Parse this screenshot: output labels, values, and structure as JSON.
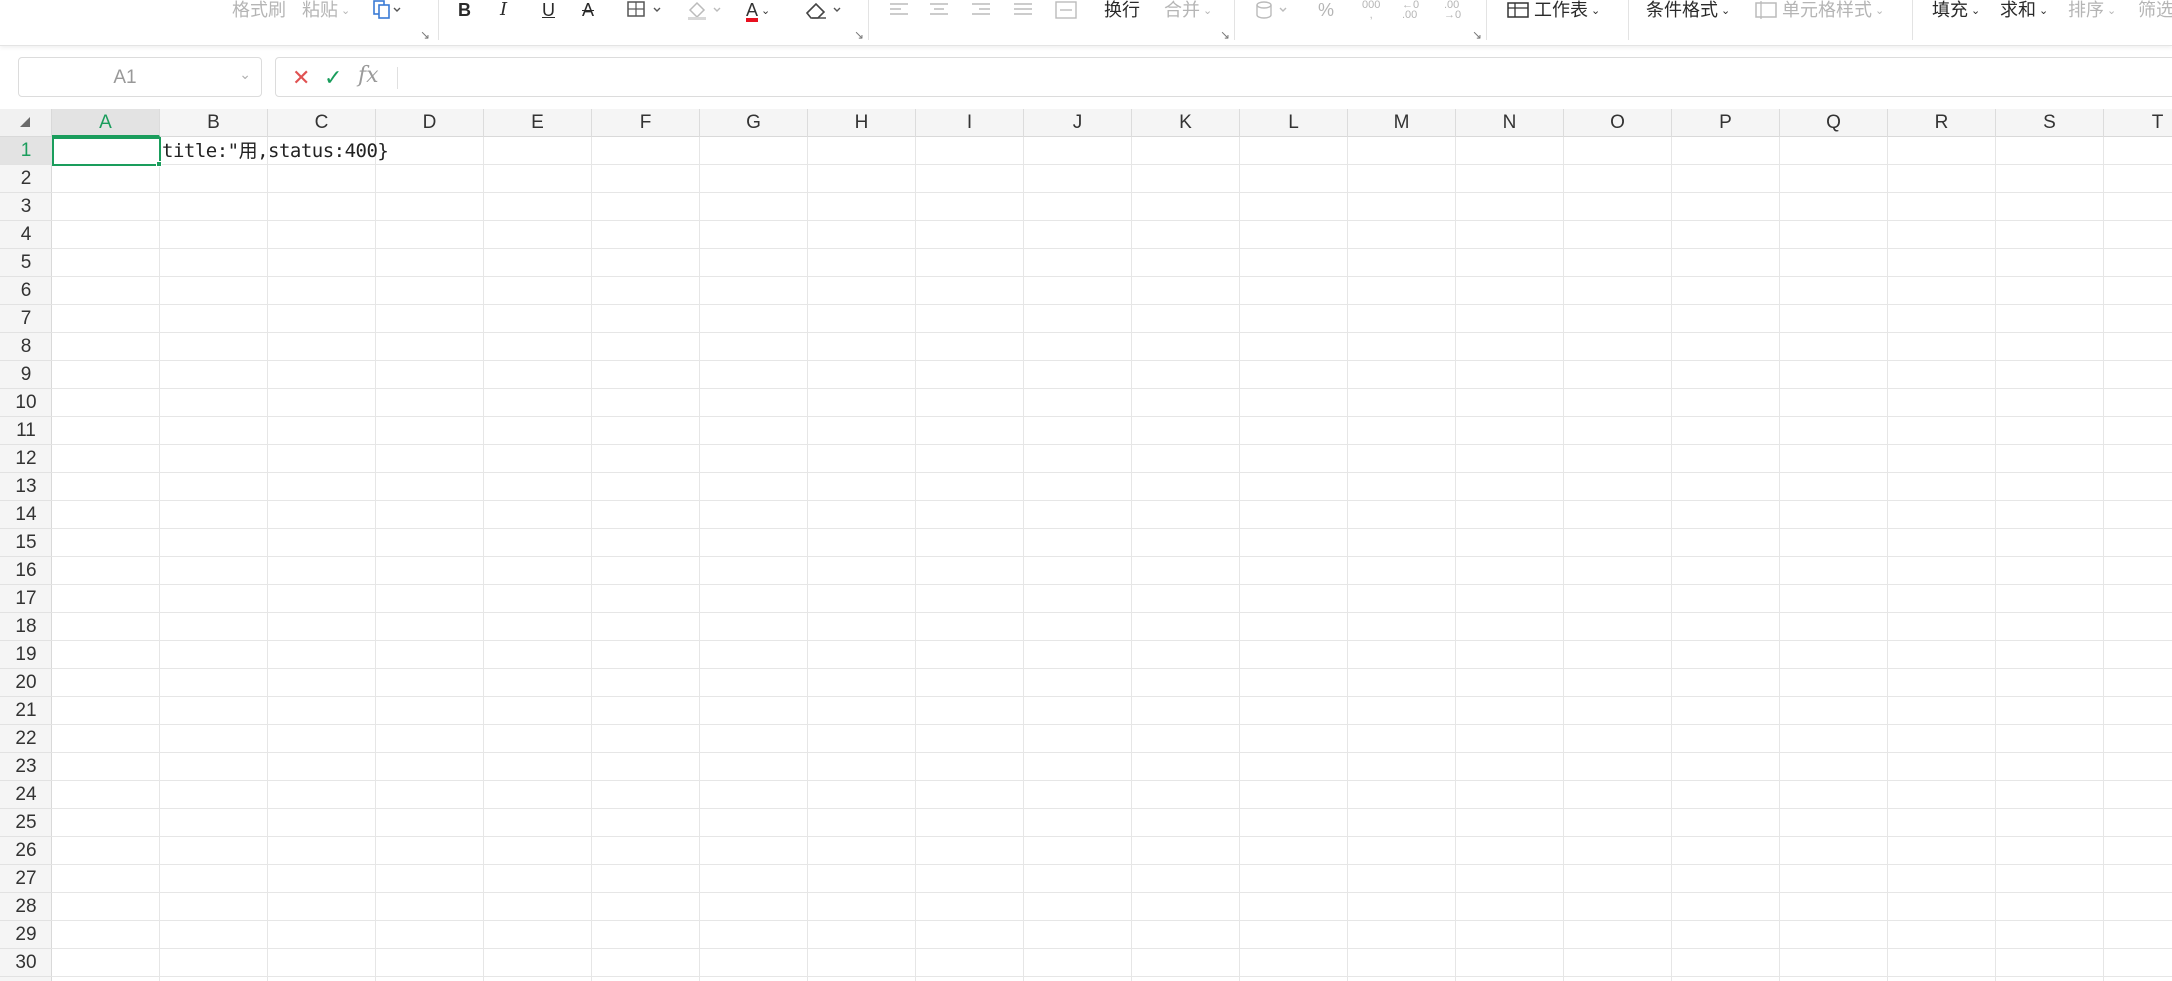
{
  "ribbon": {
    "format_painter": "格式刷",
    "paste": "粘贴",
    "bold": "B",
    "italic": "I",
    "underline": "U",
    "strikethrough": "A",
    "font_color_letter": "A",
    "wrap_text": "换行",
    "merge": "合并",
    "percent": "%",
    "thousands": "000",
    "thousands_sub": ",",
    "dec_increase_top": "←0",
    "dec_increase_bottom": ".00",
    "dec_decrease_top": ".00",
    "dec_decrease_bottom": "→0",
    "worksheet": "工作表",
    "conditional_format": "条件格式",
    "cell_style": "单元格样式",
    "fill": "填充",
    "sum": "求和",
    "sort": "排序",
    "filter": "筛选",
    "font_color_hex": "#e8101f",
    "accent_hex": "#1a9d5c"
  },
  "formula_bar": {
    "name_box": "A1",
    "cancel_icon": "✕",
    "confirm_icon": "✓",
    "fx_label": "fx",
    "content": ""
  },
  "grid": {
    "corner_icon": "select-all-triangle",
    "columns": [
      "A",
      "B",
      "C",
      "D",
      "E",
      "F",
      "G",
      "H",
      "I",
      "J",
      "K",
      "L",
      "M",
      "N",
      "O",
      "P",
      "Q",
      "R",
      "S",
      "T"
    ],
    "rows": [
      "1",
      "2",
      "3",
      "4",
      "5",
      "6",
      "7",
      "8",
      "9",
      "10",
      "11",
      "12",
      "13",
      "14",
      "15",
      "16",
      "17",
      "18",
      "19",
      "20",
      "21",
      "22",
      "23",
      "24",
      "25",
      "26",
      "27",
      "28",
      "29",
      "30"
    ],
    "active_column": "A",
    "active_row": "1",
    "cells": {
      "B1": "title:\"用,status:400}"
    }
  }
}
